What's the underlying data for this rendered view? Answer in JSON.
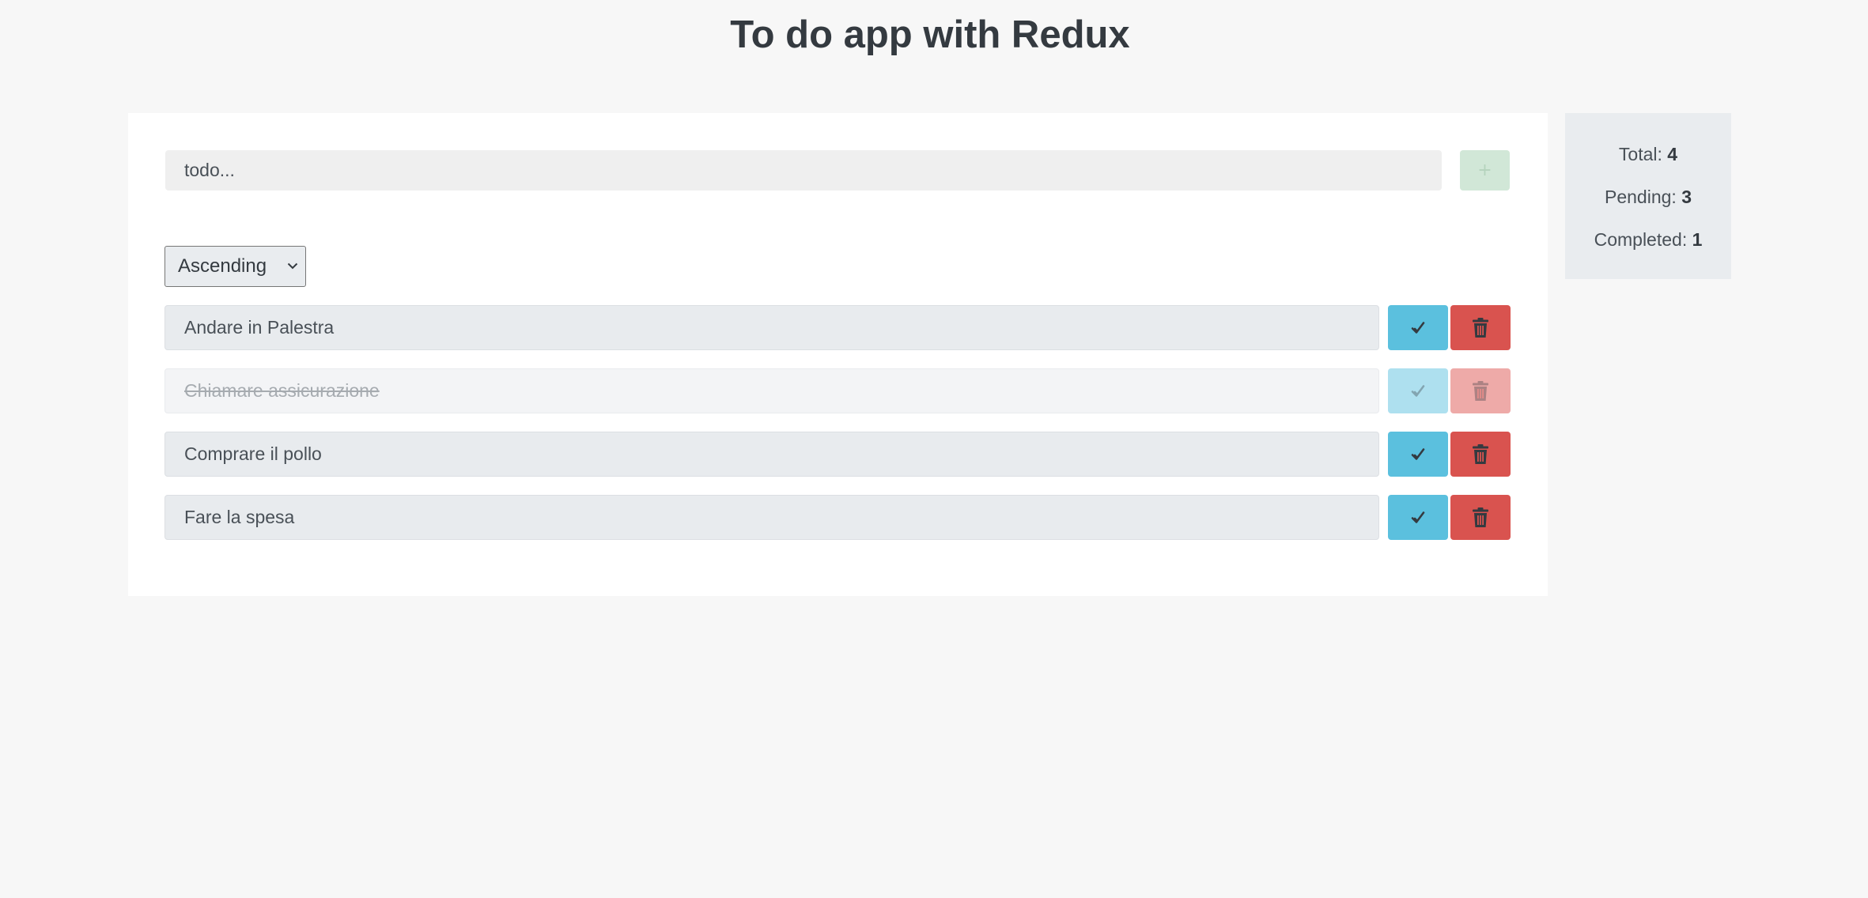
{
  "header": {
    "title": "To do app with Redux"
  },
  "form": {
    "input_placeholder": "todo...",
    "input_value": "",
    "add_label": "+"
  },
  "sort": {
    "selected": "Ascending"
  },
  "todos": [
    {
      "text": "Andare in Palestra",
      "completed": false
    },
    {
      "text": "Chiamare assicurazione",
      "completed": true
    },
    {
      "text": "Comprare il pollo",
      "completed": false
    },
    {
      "text": "Fare la spesa",
      "completed": false
    }
  ],
  "stats": {
    "total_label": "Total:",
    "total_value": "4",
    "pending_label": "Pending:",
    "pending_value": "3",
    "completed_label": "Completed:",
    "completed_value": "1"
  },
  "icons": {
    "complete": "check-icon",
    "delete": "trash-icon",
    "dropdown": "chevron-down-icon"
  },
  "colors": {
    "complete_button": "#5bc0de",
    "delete_button": "#d9534f",
    "add_button": "#d1e7d7",
    "page_background": "#f7f7f7"
  }
}
